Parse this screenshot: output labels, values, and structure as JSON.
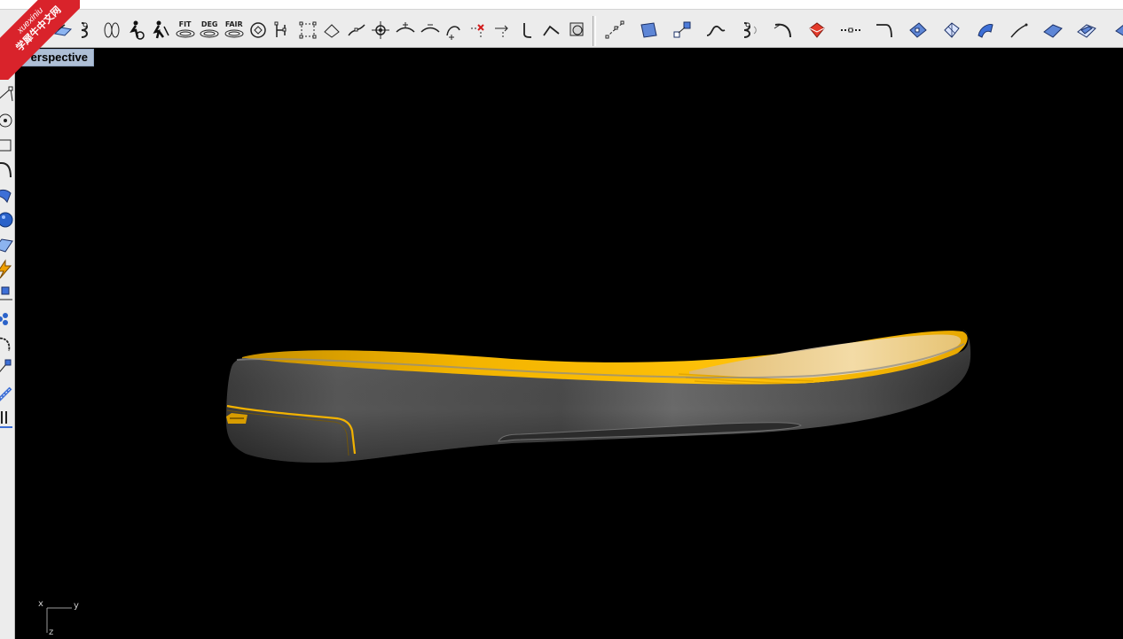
{
  "viewport": {
    "label": "Perspective",
    "background": "#000000",
    "axis": {
      "x": "x",
      "y": "y",
      "z": "z"
    }
  },
  "watermark": {
    "line1": "xuexiniu",
    "line2": "学犀牛中文网"
  },
  "toolbar": {
    "fit_label": "FIT",
    "deg_label": "DEG",
    "fair_label": "FAIR"
  },
  "model": {
    "description_colors": {
      "sole": "#4a4a4a",
      "inner": "#f2b200",
      "trim": "#f2b200"
    }
  },
  "icons": [
    "rebuild-icon",
    "match-icon",
    "split-icon",
    "fillet-icon",
    "person-icon",
    "person-edit-icon",
    "fit-icon",
    "degree-icon",
    "fair-icon",
    "spiral-icon",
    "points-icon",
    "cage-icon",
    "curve-icon",
    "control-points-icon",
    "weight-icon",
    "insert-knot-icon",
    "remove-knot-icon",
    "add-kink-icon",
    "delete-point-icon",
    "move-uvn-icon",
    "corner-icon",
    "edit-curve-icon",
    "extract-icon",
    "polyline-points-icon",
    "surface-icon",
    "point-edit-icon",
    "blend-curve-icon",
    "crv-match-icon",
    "fillet-curve-icon",
    "shield-icon",
    "dashed-line-icon",
    "trim-corner-icon",
    "plane-icon",
    "shaded-surface-icon",
    "sweep-icon",
    "arc-icon",
    "patch-icon",
    "offset-surface-icon"
  ]
}
